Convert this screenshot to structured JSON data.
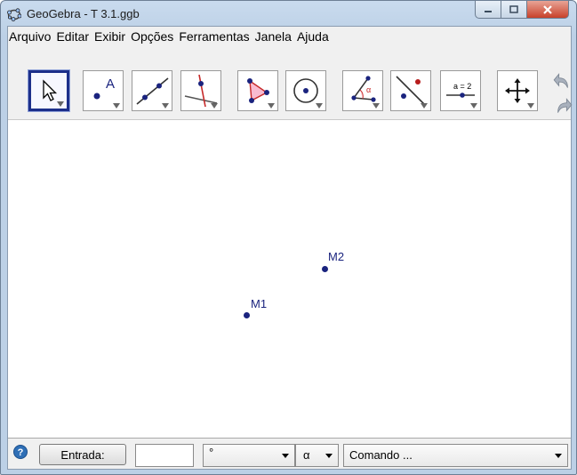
{
  "window": {
    "title": "GeoGebra - T 3.1.ggb"
  },
  "menu": [
    "Arquivo",
    "Editar",
    "Exibir",
    "Opções",
    "Ferramentas",
    "Janela",
    "Ajuda"
  ],
  "toolbar": {
    "tools": [
      {
        "name": "move-tool",
        "icon": "arrow-cursor-icon",
        "selected": true
      },
      {
        "name": "point-tool",
        "icon": "point-a-icon"
      },
      {
        "name": "line-tool",
        "icon": "line-through-points-icon"
      },
      {
        "name": "perpendicular-tool",
        "icon": "perpendicular-line-icon"
      },
      {
        "name": "polygon-tool",
        "icon": "polygon-icon"
      },
      {
        "name": "circle-tool",
        "icon": "circle-center-icon"
      },
      {
        "name": "angle-tool",
        "icon": "angle-icon"
      },
      {
        "name": "reflect-tool",
        "icon": "reflect-point-icon"
      },
      {
        "name": "slider-tool",
        "icon": "slider-icon",
        "label": "a = 2"
      },
      {
        "name": "move-view-tool",
        "icon": "move-graphics-icon"
      }
    ],
    "undo_icon": "undo-icon",
    "redo_icon": "redo-icon"
  },
  "canvas": {
    "points": [
      {
        "label": "M2"
      },
      {
        "label": "M1"
      }
    ]
  },
  "input_bar": {
    "entrada_label": "Entrada:",
    "input_value": "",
    "symbol_combo": "°",
    "greek_combo": "α",
    "command_combo": "Comando ..."
  },
  "colors": {
    "point": "#1a237e",
    "selected_tool": "#1d2f8a"
  }
}
